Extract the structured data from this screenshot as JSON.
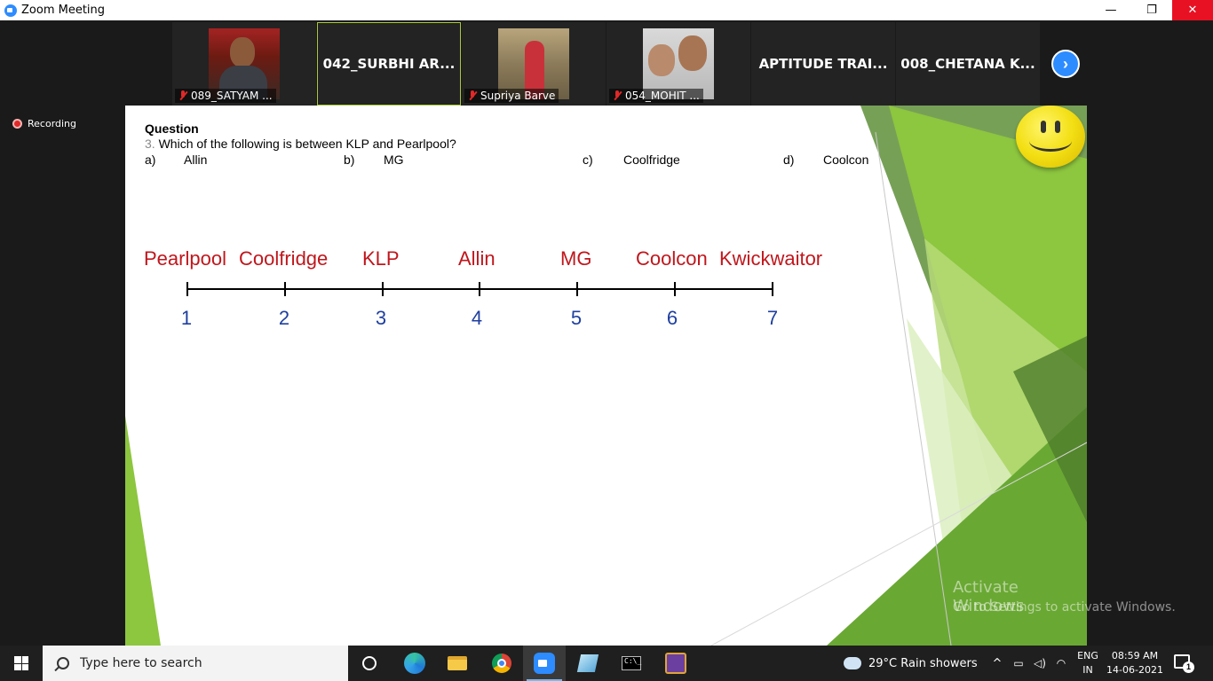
{
  "window": {
    "title": "Zoom Meeting",
    "minimize": "—",
    "maximize": "❐",
    "close": "✕"
  },
  "gallery": {
    "tiles": [
      {
        "label": "089_SATYAM ...",
        "muted": true,
        "has_video": true
      },
      {
        "label": "042_SURBHI AR...",
        "muted": false,
        "has_video": false,
        "active_speaker": true
      },
      {
        "label": "Supriya Barve",
        "muted": true,
        "has_video": true
      },
      {
        "label": "054_MOHIT ...",
        "muted": true,
        "has_video": true
      },
      {
        "label": "APTITUDE TRAI...",
        "muted": false,
        "has_video": false
      },
      {
        "label": "008_CHETANA K...",
        "muted": false,
        "has_video": false
      }
    ],
    "next_icon": "chevron-right-icon"
  },
  "recording": {
    "label": "Recording"
  },
  "slide": {
    "heading": "Question",
    "question_number": "3.",
    "question": "Which of the following is between KLP and Pearlpool?",
    "options": [
      {
        "letter": "a)",
        "text": "Allin"
      },
      {
        "letter": "b)",
        "text": "MG"
      },
      {
        "letter": "c)",
        "text": "Coolfridge"
      },
      {
        "letter": "d)",
        "text": "Coolcon"
      }
    ],
    "line_words": [
      "Pearlpool",
      "Coolfridge",
      "KLP",
      "Allin",
      "MG",
      "Coolcon",
      "Kwickwaitor"
    ],
    "line_numbers": [
      "1",
      "2",
      "3",
      "4",
      "5",
      "6",
      "7"
    ],
    "colors": {
      "words": "#c0161c",
      "numbers": "#1f3fa0",
      "accent_green": "#8dc63f"
    }
  },
  "watermark": {
    "line1": "Activate Windows",
    "line2": "Go to Settings to activate Windows."
  },
  "taskbar": {
    "search_placeholder": "Type here to search",
    "weather": "29°C  Rain showers",
    "lang_top": "ENG",
    "lang_bottom": "IN",
    "time": "08:59 AM",
    "date": "14-06-2021",
    "notification_count": "1",
    "tray_up": "^"
  }
}
